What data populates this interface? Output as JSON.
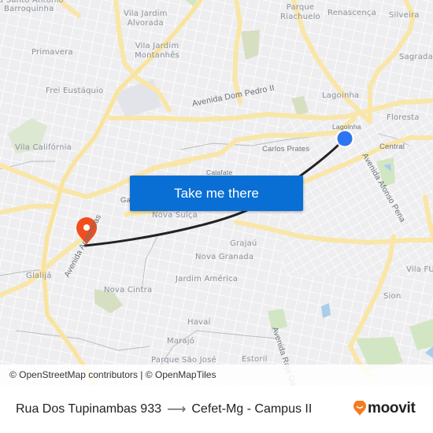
{
  "map": {
    "labels": {
      "santo_antonio": "a Santo Antônio",
      "barroquinha": "Barroquinha",
      "vila_jardim_alvorada_1": "Vila Jardim",
      "vila_jardim_alvorada_2": "Alvorada",
      "vila_jardim_montanhes_1": "Vila Jardim",
      "vila_jardim_montanhes_2": "Montanhês",
      "parque_riachuelo_1": "Parque",
      "parque_riachuelo_2": "Riachuelo",
      "renascenca": "Renascença",
      "silveira": "Silveira",
      "sagrada": "Sagrada",
      "primavera": "Primavera",
      "frei_eustaquio": "Frei Eustáquio",
      "lagoinha_top": "Lagoinha",
      "avenida_dom_pedro": "Avenida Dom Pedro II",
      "floresta": "Floresta",
      "lagoinha_small": "Lagoinha",
      "vila_california": "Vila Califórnia",
      "carlos_prates": "Carlos Prates",
      "central": "Central",
      "calafate": "Calafate",
      "avenida_afonso_pena": "Avenida Afonso Pena",
      "gameleira": "Ga",
      "nova_suica": "Nova Suíça",
      "avenida_amazonas": "Avenida Amazonas",
      "grajau": "Grajaú",
      "nova_granada": "Nova Granada",
      "glalija": "Glalijá",
      "jardim_america": "Jardim América",
      "vila_fu": "Vila FU",
      "nova_cintra": "Nova Cintra",
      "sion": "Sion",
      "havai": "Havaí",
      "marajo": "Marajó",
      "parque_sao_jose": "Parque São José",
      "estoril": "Estoril",
      "avenida_raja": "Avenida Raja Ga"
    },
    "origin_marker_color": "#2b76f0",
    "destination_marker_color": "#f14e1c",
    "route_color": "#222222"
  },
  "cta": {
    "label": "Take me there",
    "color": "#0a6fd4"
  },
  "attribution": "© OpenStreetMap contributors | © OpenMapTiles",
  "footer": {
    "origin": "Rua Dos Tupinambas 933",
    "arrow": "⟶",
    "destination": "Cefet-Mg - Campus II",
    "brand": "moovit",
    "brand_color": "#f47b20"
  }
}
